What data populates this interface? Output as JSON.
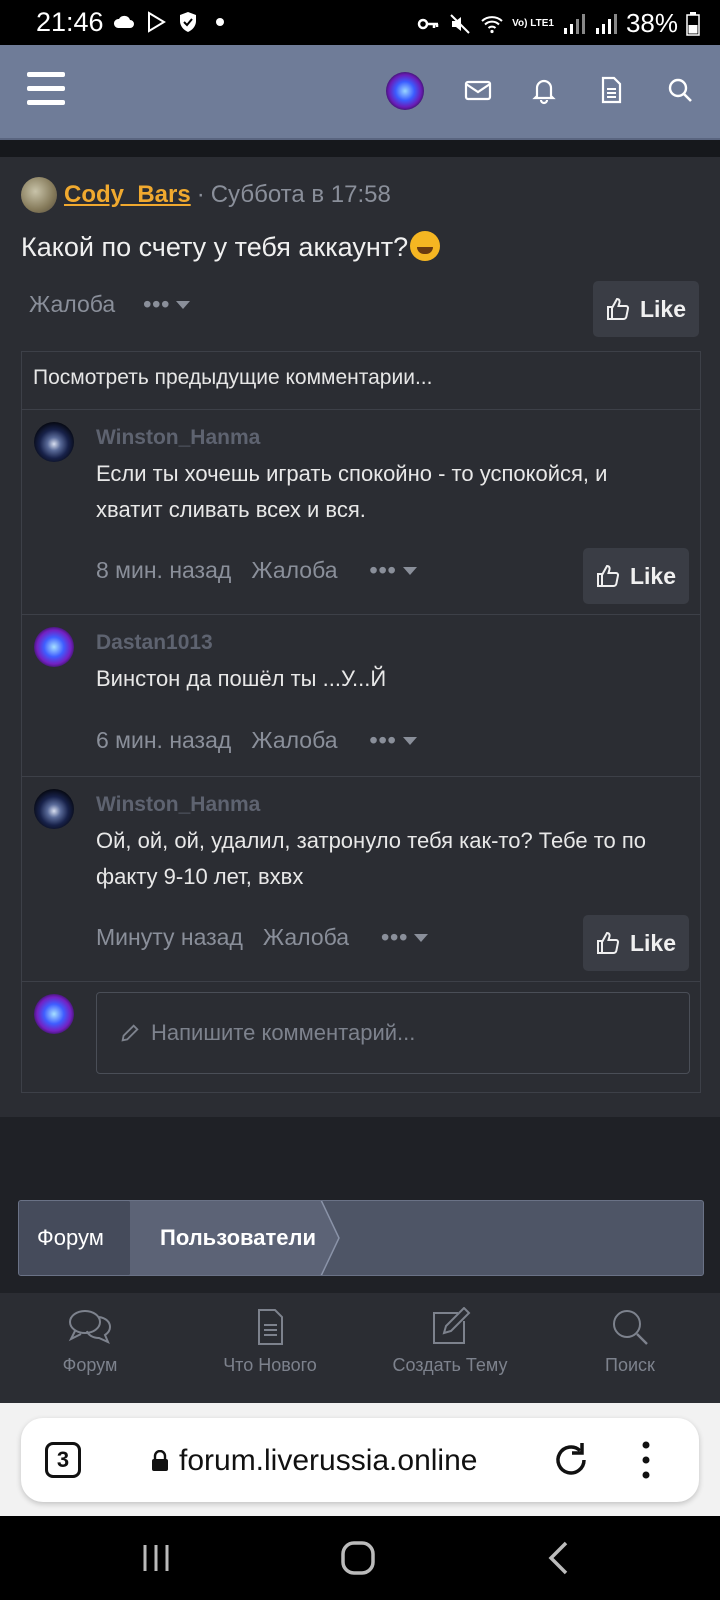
{
  "status_bar": {
    "time": "21:46",
    "battery": "38%",
    "network_label": "Vo) LTE1"
  },
  "header": {
    "menu_icon": "hamburger-icon",
    "icons": [
      "envelope-icon",
      "bell-icon",
      "document-icon",
      "search-icon"
    ]
  },
  "post": {
    "author": "Cody_Bars",
    "separator": "·",
    "time": "Суббота в 17:58",
    "text": "Какой по счету у тебя аккаунт?",
    "emoji": "😆",
    "report_label": "Жалоба",
    "more_label": "•••",
    "like_label": "Like"
  },
  "comments": {
    "view_previous": "Посмотреть предыдущие комментарии...",
    "items": [
      {
        "author": "Winston_Hanma",
        "text": "Если ты хочешь играть спокойно - то успокойся, и хватит сливать всех и вся.",
        "time": "8 мин. назад",
        "report": "Жалоба",
        "more": "•••",
        "like": "Like"
      },
      {
        "author": "Dastan1013",
        "text": "Винстон да пошёл ты ...У...Й",
        "time": "6 мин. назад",
        "report": "Жалоба",
        "more": "•••"
      },
      {
        "author": "Winston_Hanma",
        "text": "Ой, ой, ой, удалил, затронуло тебя как-то? Тебе то по факту 9-10 лет, вхвх",
        "time": "Минуту назад",
        "report": "Жалоба",
        "more": "•••",
        "like": "Like"
      }
    ],
    "input_placeholder": "Напишите комментарий..."
  },
  "breadcrumb": {
    "items": [
      "Форум",
      "Пользователи"
    ]
  },
  "bottom_nav": {
    "items": [
      {
        "label": "Форум",
        "icon": "chat-bubbles-icon"
      },
      {
        "label": "Что Нового",
        "icon": "document-icon"
      },
      {
        "label": "Создать Тему",
        "icon": "edit-icon"
      },
      {
        "label": "Поиск",
        "icon": "search-icon"
      }
    ]
  },
  "browser": {
    "tab_count": "3",
    "url": "forum.liverussia.online"
  }
}
